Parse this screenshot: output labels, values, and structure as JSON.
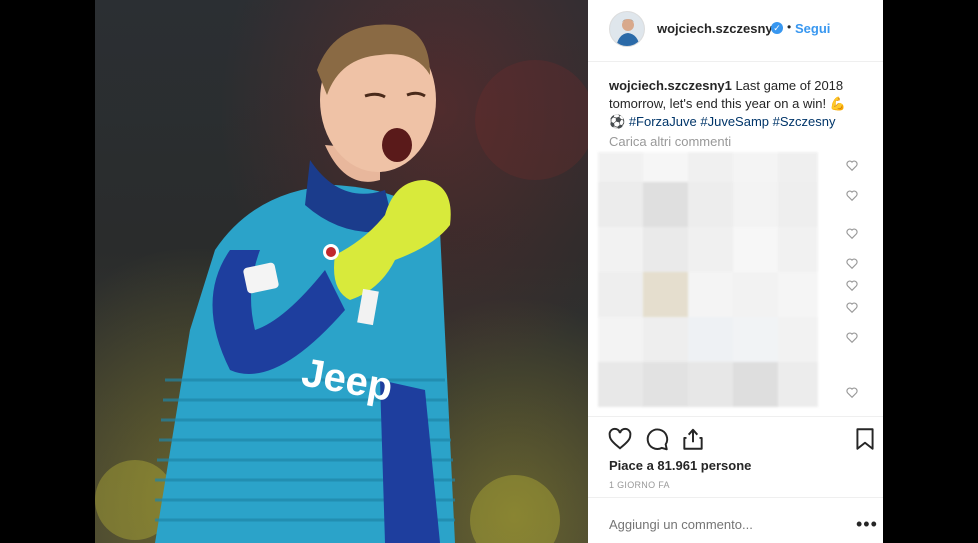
{
  "post": {
    "username": "wojciech.szczesny1",
    "verified_badge": "✓",
    "separator": "•",
    "follow_label": "Segui",
    "caption": {
      "username": "wojciech.szczesny1",
      "text": " Last game of 2018 tomorrow, let's end this year on a win! ",
      "emoji_muscle": "💪",
      "emoji_ball": "⚽",
      "hashtags": [
        "#ForzaJuve",
        "#JuveSamp",
        "#Szczesny"
      ]
    },
    "load_more_label": "Carica altri commenti",
    "likes_label": "Piace a 81.961 persone",
    "timestamp": "1 GIORNO FA",
    "comment_placeholder": "Aggiungi un commento...",
    "more_options": "•••"
  },
  "icons": {
    "verified": "verified-badge-icon",
    "like": "heart-icon",
    "comment": "comment-bubble-icon",
    "share": "share-icon",
    "save": "bookmark-icon",
    "more": "more-options-icon"
  },
  "colors": {
    "accent": "#3897f0",
    "hashtag": "#003569",
    "muted": "#999999",
    "jersey": "#2aa3c8"
  }
}
